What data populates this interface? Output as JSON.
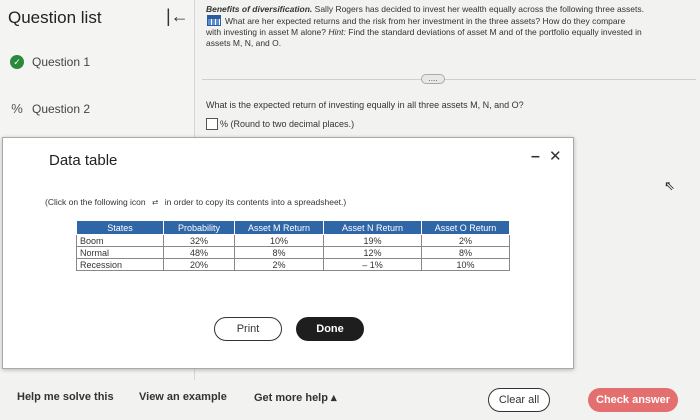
{
  "sidebar": {
    "title": "Question list",
    "collapse_icon": "collapse-left-icon",
    "items": [
      {
        "label": "Question 1",
        "status_icon": "check-circle-icon",
        "status_color": "#2a8a3a"
      },
      {
        "label": "Question 2",
        "status_icon": "partial-credit-icon"
      }
    ]
  },
  "intro": {
    "heading": "Benefits of diversification.",
    "line1": "Sally Rogers has decided to invest her wealth equally across the following three assets.",
    "line2": "What are her expected returns and the risk from her investment in the three assets? How do they compare",
    "line3": "with investing in asset M alone?",
    "hint_label": "Hint:",
    "hint_text": "Find the standard deviations of asset M and of the portfolio equally invested in",
    "line4": "assets M, N, and O."
  },
  "expand_button": "....",
  "question": "What is the expected return of investing equally in all three assets M, N, and O?",
  "answer": {
    "value": "",
    "suffix": "% (Round to two decimal places.)"
  },
  "modal": {
    "title": "Data table",
    "minimize": "–",
    "close": "✕",
    "copy_note_before": "(Click on the following icon",
    "copy_note_after": "in order to copy its contents into a spreadsheet.)",
    "table": {
      "headers": [
        "States",
        "Probability",
        "Asset M Return",
        "Asset N Return",
        "Asset O Return"
      ],
      "rows": [
        [
          "Boom",
          "32%",
          "10%",
          "19%",
          "2%"
        ],
        [
          "Normal",
          "48%",
          "8%",
          "12%",
          "8%"
        ],
        [
          "Recession",
          "20%",
          "2%",
          "– 1%",
          "10%"
        ]
      ]
    },
    "print_label": "Print",
    "done_label": "Done"
  },
  "footer": {
    "help": "Help me solve this",
    "example": "View an example",
    "more_help": "Get more help ▴",
    "clear": "Clear all",
    "check": "Check answer",
    "check_color": "#e36f6f"
  }
}
